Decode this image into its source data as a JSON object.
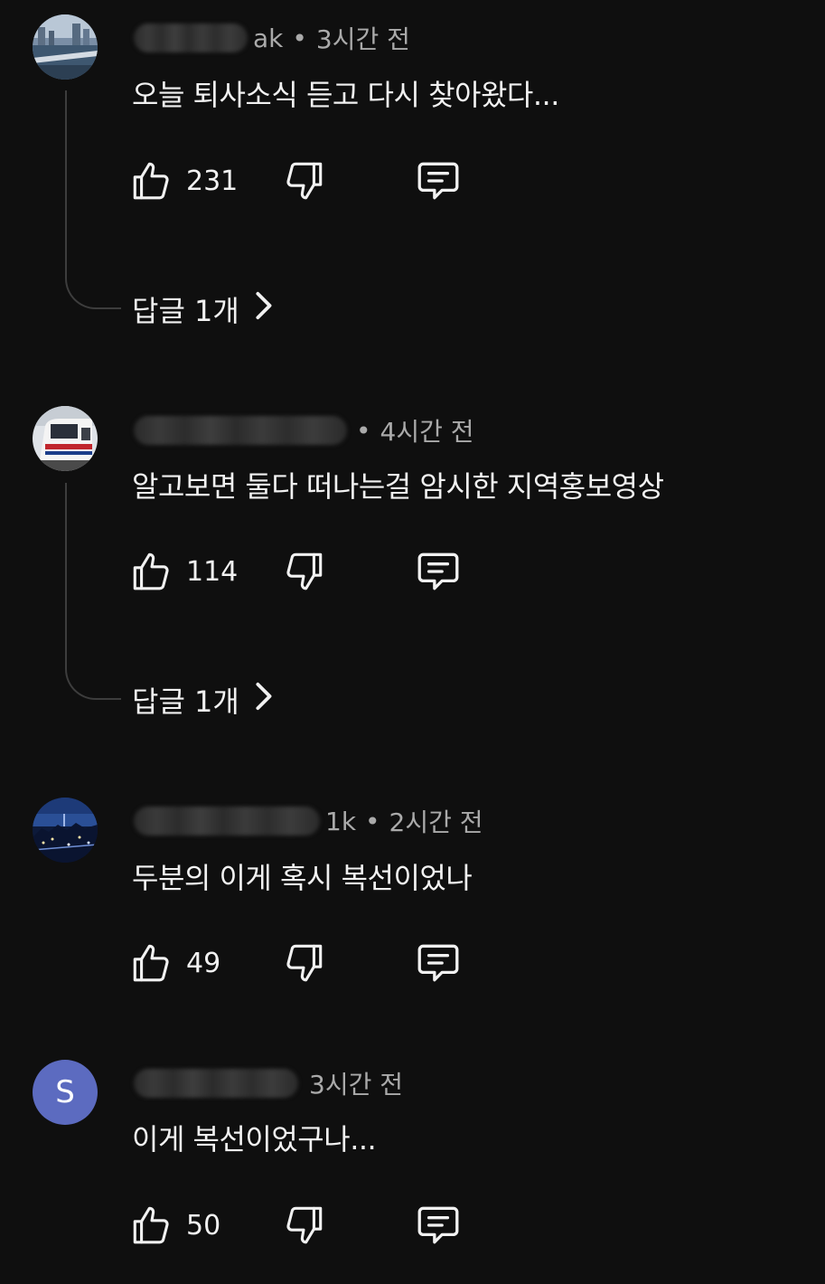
{
  "comments": [
    {
      "author_suffix": "ak",
      "separator": "•",
      "time": "3시간 전",
      "text": "오늘 퇴사소식 듣고 다시 찾아왔다...",
      "likes": "231",
      "replies_label": "답글 1개"
    },
    {
      "author_suffix": "",
      "separator": "•",
      "time": "4시간 전",
      "text": "알고보면 둘다 떠나는걸 암시한 지역홍보영상",
      "likes": "114",
      "replies_label": "답글 1개"
    },
    {
      "author_suffix": "1k",
      "separator": "•",
      "time": "2시간 전",
      "text": "두분의 이게 혹시 복선이었나",
      "likes": "49"
    },
    {
      "avatar_letter": "S",
      "author_suffix": "",
      "separator": "",
      "time": "3시간 전",
      "text": "이게 복선이었구나...",
      "likes": "50"
    }
  ],
  "icons": {
    "like": "thumbs-up-icon",
    "dislike": "thumbs-down-icon",
    "reply": "comment-icon",
    "expand": "chevron-right-icon"
  },
  "colors": {
    "background": "#0f0f0f",
    "text_primary": "#f1f1f1",
    "text_secondary": "#aaaaaa",
    "avatar_letter_bg": "#5c6bc0"
  }
}
